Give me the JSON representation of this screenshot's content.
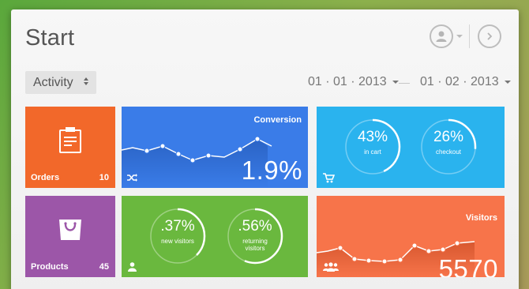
{
  "header": {
    "title": "Start"
  },
  "filter": {
    "selected": "Activity",
    "date_from": "01 · 01 · 2013",
    "date_to": "01 · 02 · 2013"
  },
  "tiles": {
    "orders": {
      "label": "Orders",
      "count": "10"
    },
    "conversion": {
      "label": "Conversion",
      "value": "1.9%"
    },
    "cart": {
      "in_cart_value": "43%",
      "in_cart_label": "in cart",
      "checkout_value": "26%",
      "checkout_label": "checkout"
    },
    "products": {
      "label": "Products",
      "count": "45"
    },
    "visitors_split": {
      "new_value": ".37%",
      "new_label": "new visitors",
      "returning_value": ".56%",
      "returning_label_1": "returning",
      "returning_label_2": "visitors"
    },
    "visitors": {
      "label": "Visitors",
      "value": "5570"
    }
  },
  "colors": {
    "orders": "#f2682a",
    "conversion": "#3a7ce8",
    "cart": "#2ab3ee",
    "products": "#9c56a8",
    "visitors_split": "#6ab83e",
    "visitors": "#f7744a"
  },
  "icons": {
    "user": "user-icon",
    "forward": "arrow-right-icon",
    "orders": "clipboard-icon",
    "conversion": "shuffle-icon",
    "cart": "cart-icon",
    "products": "shopping-bag-icon",
    "visitor": "person-icon",
    "visitors": "users-icon"
  }
}
